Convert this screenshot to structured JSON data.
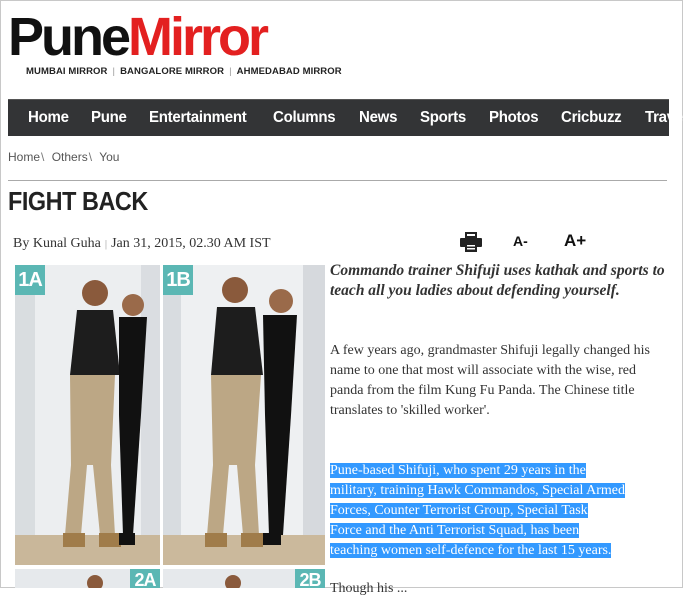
{
  "site": {
    "logo_pune": "Pune",
    "logo_mirror": "Mirror",
    "sister_sites": [
      "MUMBAI MIRROR",
      "BANGALORE MIRROR",
      "AHMEDABAD MIRROR"
    ],
    "sister_sep": "|"
  },
  "nav": {
    "items": [
      "Home",
      "Pune",
      "Entertainment",
      "Columns",
      "News",
      "Sports",
      "Photos",
      "Cricbuzz",
      "Travel"
    ]
  },
  "breadcrumb": {
    "items": [
      "Home",
      "Others",
      "You"
    ],
    "sep": "\\"
  },
  "article": {
    "title": "FIGHT BACK",
    "byline": "By Kunal Guha",
    "date": "Jan 31, 2015, 02.30 AM IST",
    "byline_sep": "|",
    "tools": {
      "font_decrease": "A-",
      "font_increase": "A+",
      "print_icon": "printer-icon"
    },
    "photo_labels": [
      "1A",
      "1B",
      "2A",
      "2B"
    ],
    "lede": "Commando trainer Shifuji uses kathak and sports to teach all you ladies about defending yourself.",
    "paragraph_1": "A few years ago, grandmaster Shifuji legally changed his name to one that most will associate with the wise, red panda from the film Kung Fu Panda. The Chinese title translates to 'skilled worker'.",
    "paragraph_2_lines": [
      "Pune-based Shifuji, who spent 29 years in the",
      "military, training Hawk Commandos, Special Armed",
      "Forces, Counter Terrorist Group, Special Task",
      "Force and the Anti Terrorist Squad, has been",
      "teaching women self-defence for the last 15 years."
    ],
    "paragraph_3": "Though his ..."
  },
  "colors": {
    "brand_red": "#e32020",
    "nav_bg": "#333436",
    "photo_tag": "#5bb7b4",
    "selection": "#3399ff"
  }
}
